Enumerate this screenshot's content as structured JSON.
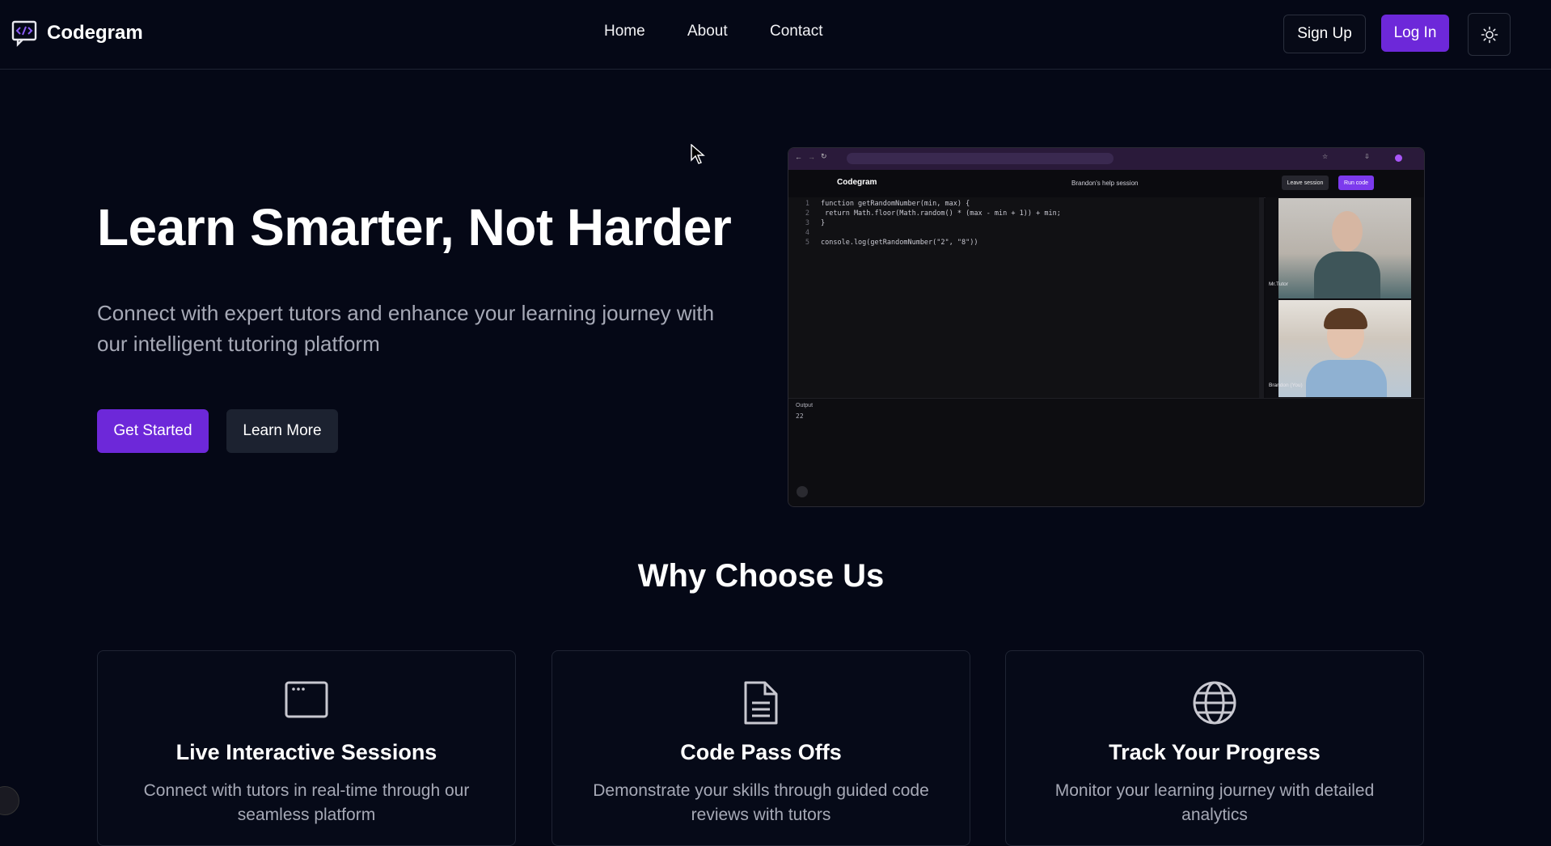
{
  "brand": {
    "name": "Codegram"
  },
  "nav": {
    "links": [
      "Home",
      "About",
      "Contact"
    ],
    "signup_label": "Sign Up",
    "login_label": "Log In",
    "theme_icon": "sun-icon"
  },
  "colors": {
    "accent": "#6d28d9",
    "background": "#050816",
    "muted_text": "#a6a9b6"
  },
  "hero": {
    "title": "Learn Smarter, Not Harder",
    "subtitle": "Connect with expert tutors and enhance your learning journey with our intelligent tutoring platform",
    "primary_cta": "Get Started",
    "secondary_cta": "Learn More"
  },
  "mockup": {
    "app_name": "Codegram",
    "session_title": "Brandon's help session",
    "leave_label": "Leave session",
    "run_label": "Run code",
    "code_lines": [
      {
        "n": "1",
        "text": "function getRandomNumber(min, max) {"
      },
      {
        "n": "2",
        "text": "    return Math.floor(Math.random() * (max - min + 1)) + min;"
      },
      {
        "n": "3",
        "text": "}"
      },
      {
        "n": "4",
        "text": ""
      },
      {
        "n": "5",
        "text": "console.log(getRandomNumber(\"2\", \"8\"))"
      }
    ],
    "video1_label": "Mr.Tutor",
    "video2_label": "Brandon (You)",
    "output_label": "Output",
    "output_value": "22"
  },
  "why": {
    "title": "Why Choose Us",
    "cards": [
      {
        "icon": "window-icon",
        "title": "Live Interactive Sessions",
        "desc": "Connect with tutors in real-time through our seamless platform"
      },
      {
        "icon": "document-icon",
        "title": "Code Pass Offs",
        "desc": "Demonstrate your skills through guided code reviews with tutors"
      },
      {
        "icon": "globe-icon",
        "title": "Track Your Progress",
        "desc": "Monitor your learning journey with detailed analytics"
      }
    ]
  }
}
